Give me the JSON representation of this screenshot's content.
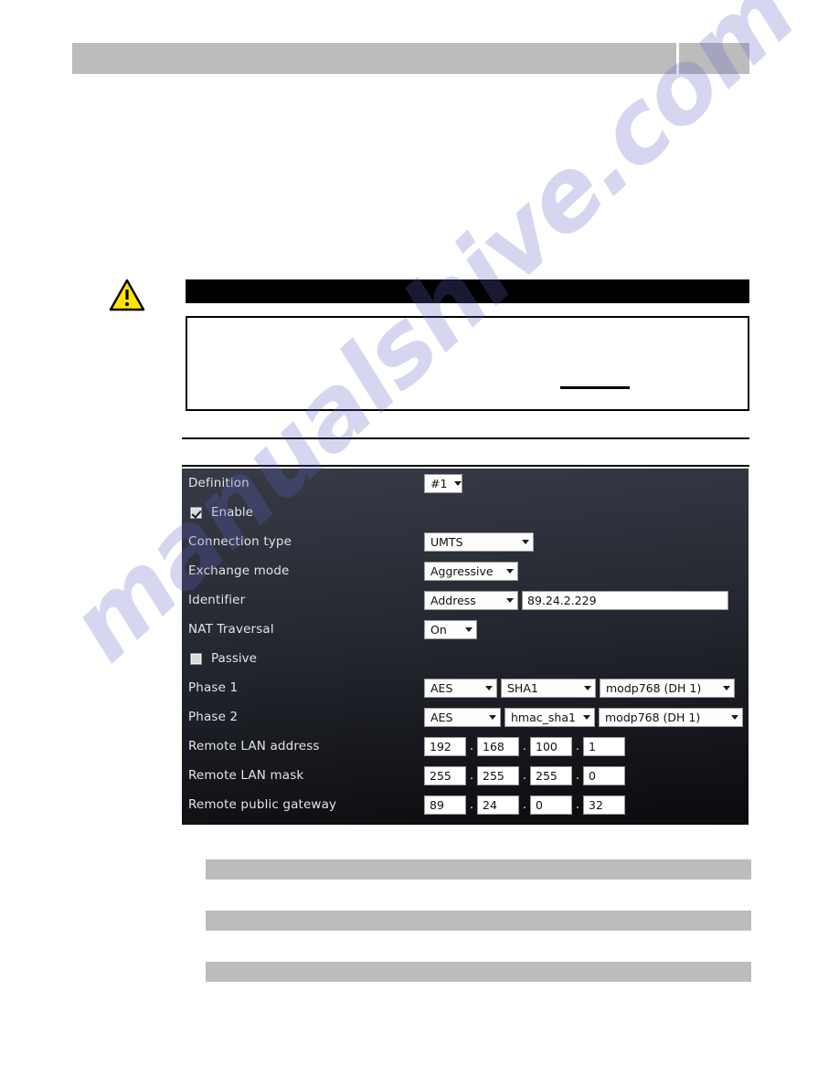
{
  "page": {
    "watermark": "manualshive.com",
    "accent_dark_panel": "#23262e",
    "accent_gray_bar": "#bcbcbc",
    "warning_icon_color": "#ffe600"
  },
  "header": {
    "left_block_label": "",
    "right_block_label": ""
  },
  "note": {
    "icon_name": "warning-triangle-icon",
    "title": "",
    "body": ""
  },
  "config_panel": {
    "rows": [
      {
        "label": "Definition",
        "type": "select",
        "value": "#1"
      },
      {
        "label": "Enable",
        "type": "checkbox",
        "checked": true
      },
      {
        "label": "Connection type",
        "type": "select",
        "value": "UMTS"
      },
      {
        "label": "Exchange mode",
        "type": "select",
        "value": "Aggressive"
      },
      {
        "label": "Identifier",
        "type": "select+text",
        "value": "Address",
        "text": "89.24.2.229"
      },
      {
        "label": "NAT Traversal",
        "type": "select",
        "value": "On"
      },
      {
        "label": "Passive",
        "type": "checkbox",
        "checked": false
      },
      {
        "label": "Phase 1",
        "type": "select3",
        "values": [
          "AES",
          "SHA1",
          "modp768 (DH 1)"
        ]
      },
      {
        "label": "Phase 2",
        "type": "select3",
        "values": [
          "AES",
          "hmac_sha1",
          "modp768 (DH 1)"
        ]
      },
      {
        "label": "Remote LAN address",
        "type": "octets",
        "octets": [
          "192",
          "168",
          "100",
          "1"
        ]
      },
      {
        "label": "Remote LAN mask",
        "type": "octets",
        "octets": [
          "255",
          "255",
          "255",
          "0"
        ]
      },
      {
        "label": "Remote public gateway",
        "type": "octets",
        "octets": [
          "89",
          "24",
          "0",
          "32"
        ]
      }
    ],
    "labels": {
      "definition": "Definition",
      "enable": "Enable",
      "connection_type": "Connection type",
      "exchange_mode": "Exchange mode",
      "identifier": "Identifier",
      "nat_traversal": "NAT Traversal",
      "passive": "Passive",
      "phase1": "Phase 1",
      "phase2": "Phase 2",
      "remote_lan_address": "Remote LAN address",
      "remote_lan_mask": "Remote LAN mask",
      "remote_public_gateway": "Remote public gateway"
    },
    "values": {
      "definition": "#1",
      "connection_type": "UMTS",
      "exchange_mode": "Aggressive",
      "identifier_type": "Address",
      "identifier_address": "89.24.2.229",
      "nat_traversal": "On",
      "phase1_encryption": "AES",
      "phase1_hash": "SHA1",
      "phase1_dh": "modp768 (DH 1)",
      "phase2_encryption": "AES",
      "phase2_hash": "hmac_sha1",
      "phase2_dh": "modp768 (DH 1)",
      "remote_lan_address": [
        "192",
        "168",
        "100",
        "1"
      ],
      "remote_lan_mask": [
        "255",
        "255",
        "255",
        "0"
      ],
      "remote_public_gateway": [
        "89",
        "24",
        "0",
        "32"
      ]
    },
    "separators": {
      "dot": "."
    }
  },
  "redacted_bars": [
    "",
    "",
    ""
  ]
}
